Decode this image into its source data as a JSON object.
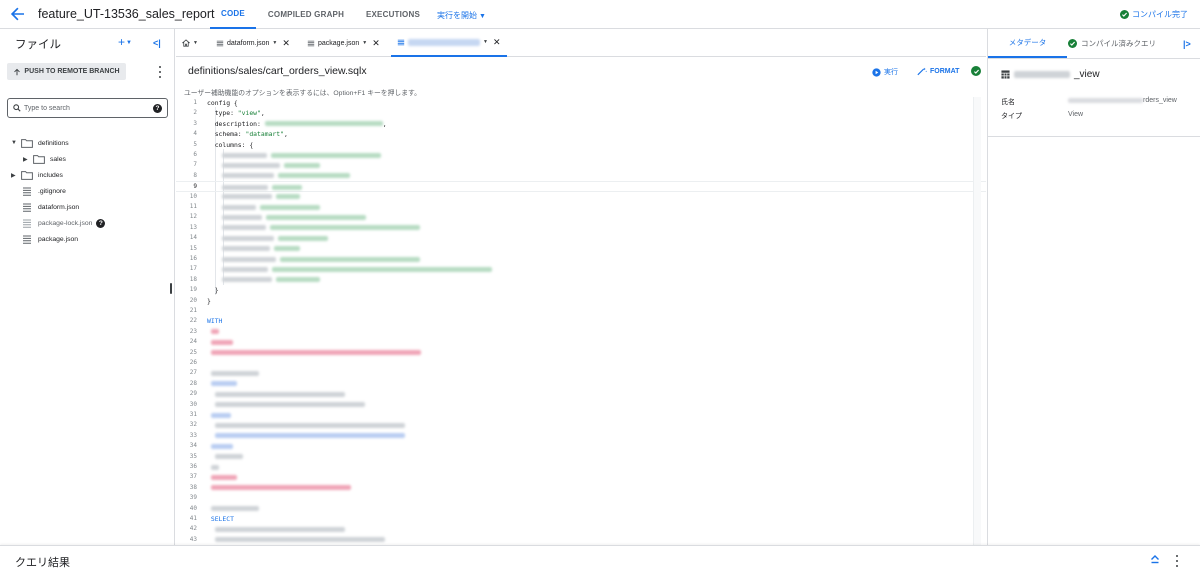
{
  "topbar": {
    "repo_title": "feature_UT-13536_sales_report",
    "tabs": [
      {
        "label": "CODE",
        "active": true
      },
      {
        "label": "COMPILED GRAPH",
        "active": false
      },
      {
        "label": "EXECUTIONS",
        "active": false
      }
    ],
    "run_menu": "実行を開始",
    "compile_status": "コンパイル完了"
  },
  "files_panel": {
    "title": "ファイル",
    "add_label": "+",
    "push_button": "PUSH TO REMOTE BRANCH",
    "search_placeholder": "Type to search",
    "tree": [
      {
        "name": "definitions",
        "type": "folder",
        "expanded": true
      },
      {
        "name": "sales",
        "type": "folder",
        "expanded": false
      },
      {
        "name": "includes",
        "type": "folder",
        "expanded": false
      },
      {
        "name": ".gitignore",
        "type": "file"
      },
      {
        "name": "dataform.json",
        "type": "file"
      },
      {
        "name": "package-lock.json",
        "type": "file"
      },
      {
        "name": "package.json",
        "type": "file"
      }
    ]
  },
  "editor": {
    "tabs": [
      {
        "label": "dataform.json",
        "active": false
      },
      {
        "label": "package.json",
        "active": false
      },
      {
        "label": "",
        "active": true
      }
    ],
    "file_path": "definitions/sales/cart_orders_view.sqlx",
    "run_label": "実行",
    "format_label": "FORMAT",
    "a11y_hint": "ユーザー補助機能のオプションを表示するには、Option+F1 キーを押します。",
    "current_line": 9,
    "lines": {
      "l1": "config {",
      "l2_key": "type: ",
      "l2_val": "\"view\"",
      "l2_end": ",",
      "l3_key": "description: ",
      "l4_key": "schema: ",
      "l4_val": "\"datamart\"",
      "l4_end": ",",
      "l5": "columns: {",
      "l19": "}",
      "l20": "}",
      "l22": "WITH",
      "l41": "SELECT"
    },
    "line_count": 43
  },
  "right_panel": {
    "tabs": [
      {
        "label": "メタデータ",
        "active": true
      },
      {
        "label": "コンパイル済みクエリ",
        "active": false
      }
    ],
    "title_suffix": "_view",
    "name_label": "氏名",
    "name_value_suffix": "rders_view",
    "type_label": "タイプ",
    "type_value": "View"
  },
  "bottom": {
    "title": "クエリ結果"
  },
  "colors": {
    "accent": "#1a73e8",
    "success": "#188038",
    "keyword": "#1a73e8",
    "string": "#188038"
  }
}
